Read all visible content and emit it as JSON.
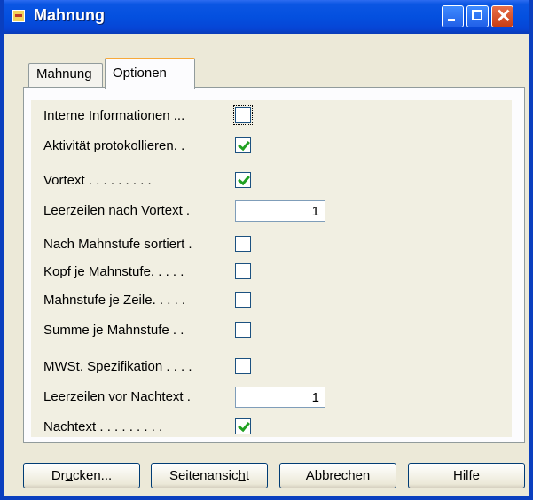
{
  "window": {
    "title": "Mahnung"
  },
  "tabs": [
    {
      "label": "Mahnung",
      "active": false
    },
    {
      "label": "Optionen",
      "active": true
    }
  ],
  "options": [
    {
      "label": "Interne Informationen ...",
      "type": "checkbox",
      "checked": false,
      "focused": true
    },
    {
      "label": "Aktivität protokollieren. .",
      "type": "checkbox",
      "checked": true
    },
    {
      "label": "Vortext . . . . . . . . .",
      "type": "checkbox",
      "checked": true
    },
    {
      "label": "Leerzeilen nach Vortext  .",
      "type": "number",
      "value": "1"
    },
    {
      "label": "Nach Mahnstufe sortiert .",
      "type": "checkbox",
      "checked": false
    },
    {
      "label": "Kopf je Mahnstufe. . . . .",
      "type": "checkbox",
      "checked": false
    },
    {
      "label": "Mahnstufe je Zeile. . . . .",
      "type": "checkbox",
      "checked": false
    },
    {
      "label": "Summe je Mahnstufe   . .",
      "type": "checkbox",
      "checked": false
    },
    {
      "label": "MWSt. Spezifikation . . . .",
      "type": "checkbox",
      "checked": false
    },
    {
      "label": "Leerzeilen vor Nachtext  .",
      "type": "number",
      "value": "1"
    },
    {
      "label": "Nachtext . . . . . . . . .",
      "type": "checkbox",
      "checked": true
    }
  ],
  "buttons": {
    "print": {
      "pre": "Dr",
      "key": "u",
      "post": "cken..."
    },
    "preview": {
      "pre": "Seitenansic",
      "key": "h",
      "post": "t"
    },
    "cancel": "Abbrechen",
    "help": "Hilfe"
  },
  "colors": {
    "titlebar": "#0450df",
    "check": "#21a121",
    "panel": "#f1efe2"
  }
}
